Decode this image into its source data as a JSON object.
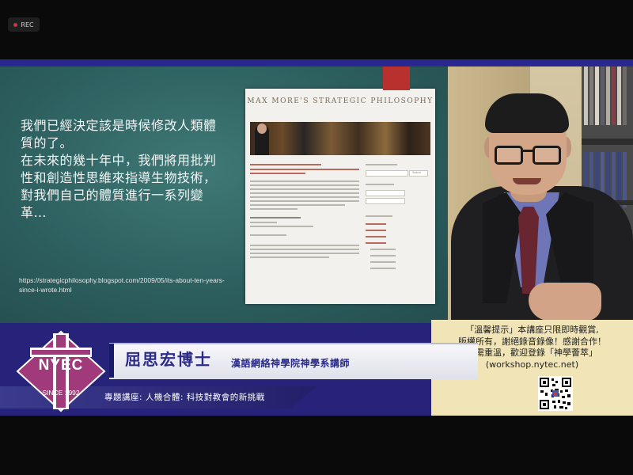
{
  "recording": {
    "label": "REC"
  },
  "slide": {
    "paragraph_1": "我們已經決定該是時候修改人類體質的了。",
    "paragraph_2": "在未來的幾十年中，我們將用批判性和創造性思維來指導生物技術，對我們自己的體質進行一系列變革…",
    "source_url": "https://strategicphilosophy.blogspot.com/2009/05/its-about-ten-years-since-i-wrote.html"
  },
  "blog": {
    "title": "MAX MORE'S STRATEGIC PHILOSOPHY",
    "search_button": "Search"
  },
  "lower_third": {
    "speaker_name": "屈思宏博士",
    "speaker_title": "漢語網絡神學院神學系講師",
    "topic": "專題講座: 人機合體:  科技對教會的新挑戰"
  },
  "logo": {
    "text": "NYEC",
    "since": "SINCE 1992"
  },
  "notice": {
    "line_1": "「溫馨提示」本講座只限即時觀賞,",
    "line_2": "版權所有，謝絕錄音錄像！感謝合作！",
    "line_3": "如需重溫，歡迎登錄「神學薈萃」",
    "line_4": "(workshop.nytec.net)"
  },
  "colors": {
    "band": "#27237a",
    "slide": "#2d5f5f",
    "notice_panel": "#f1e4b6"
  },
  "icons": {
    "rec": "record-dot-icon",
    "logo": "nyec-cross-logo-icon",
    "qr": "qr-code-icon"
  }
}
